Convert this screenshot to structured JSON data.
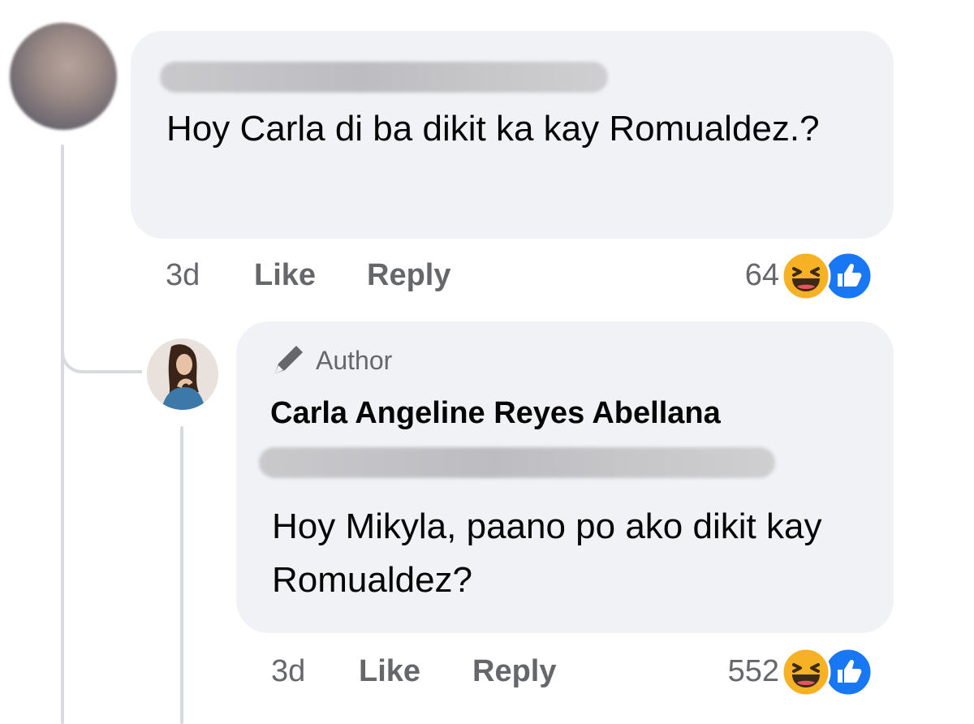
{
  "comment": {
    "body": "Hoy Carla di ba dikit ka kay Romualdez.?",
    "time": "3d",
    "like_label": "Like",
    "reply_label": "Reply",
    "reaction_count": "64",
    "reactions": [
      "haha-icon",
      "like-icon"
    ]
  },
  "reply": {
    "badge": "Author",
    "author_name": "Carla Angeline Reyes Abellana",
    "body": "Hoy Mikyla, paano po ako dikit kay Romualdez?",
    "time": "3d",
    "like_label": "Like",
    "reply_label": "Reply",
    "reaction_count": "552",
    "reactions": [
      "haha-icon",
      "like-icon"
    ]
  },
  "colors": {
    "bubble": "#f0f2f5",
    "meta_text": "#65676b",
    "like_blue": "#1877f2",
    "haha_yellow": "#f7b125"
  }
}
